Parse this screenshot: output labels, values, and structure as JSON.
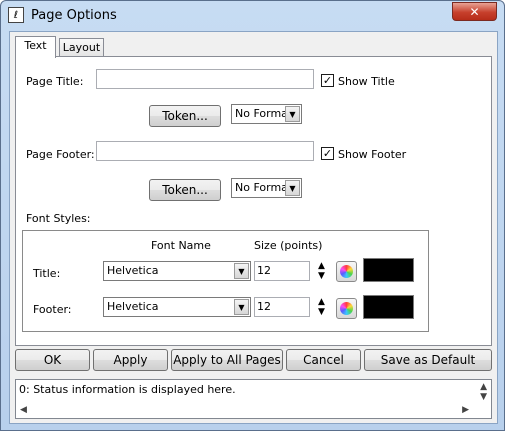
{
  "window": {
    "title": "Page Options",
    "icon": "app-icon",
    "icon_glyph": "ℓ"
  },
  "titlebar": {
    "close_glyph": "✕"
  },
  "tabs": [
    {
      "label": "Text",
      "active": true
    },
    {
      "label": "Layout",
      "active": false
    }
  ],
  "page_title": {
    "label": "Page Title:",
    "value": "",
    "show_label": "Show Title",
    "show_checked": true,
    "token_label": "Token...",
    "format_value": "No Format"
  },
  "page_footer": {
    "label": "Page Footer:",
    "value": "",
    "show_label": "Show Footer",
    "show_checked": true,
    "token_label": "Token...",
    "format_value": "No Format"
  },
  "font_styles": {
    "label": "Font Styles:",
    "font_name_header": "Font Name",
    "size_header": "Size (points)",
    "rows": [
      {
        "label": "Title:",
        "font": "Helvetica",
        "size": "12",
        "color": "#000000"
      },
      {
        "label": "Footer:",
        "font": "Helvetica",
        "size": "12",
        "color": "#000000"
      }
    ]
  },
  "buttons": {
    "ok": "OK",
    "apply": "Apply",
    "apply_all": "Apply to All Pages",
    "cancel": "Cancel",
    "save_default": "Save as Default"
  },
  "status": {
    "text": "0: Status information is displayed here."
  },
  "glyphs": {
    "check": "✓",
    "dropdown": "▼",
    "up": "▲",
    "down": "▼",
    "left": "◀",
    "right": "▶"
  }
}
